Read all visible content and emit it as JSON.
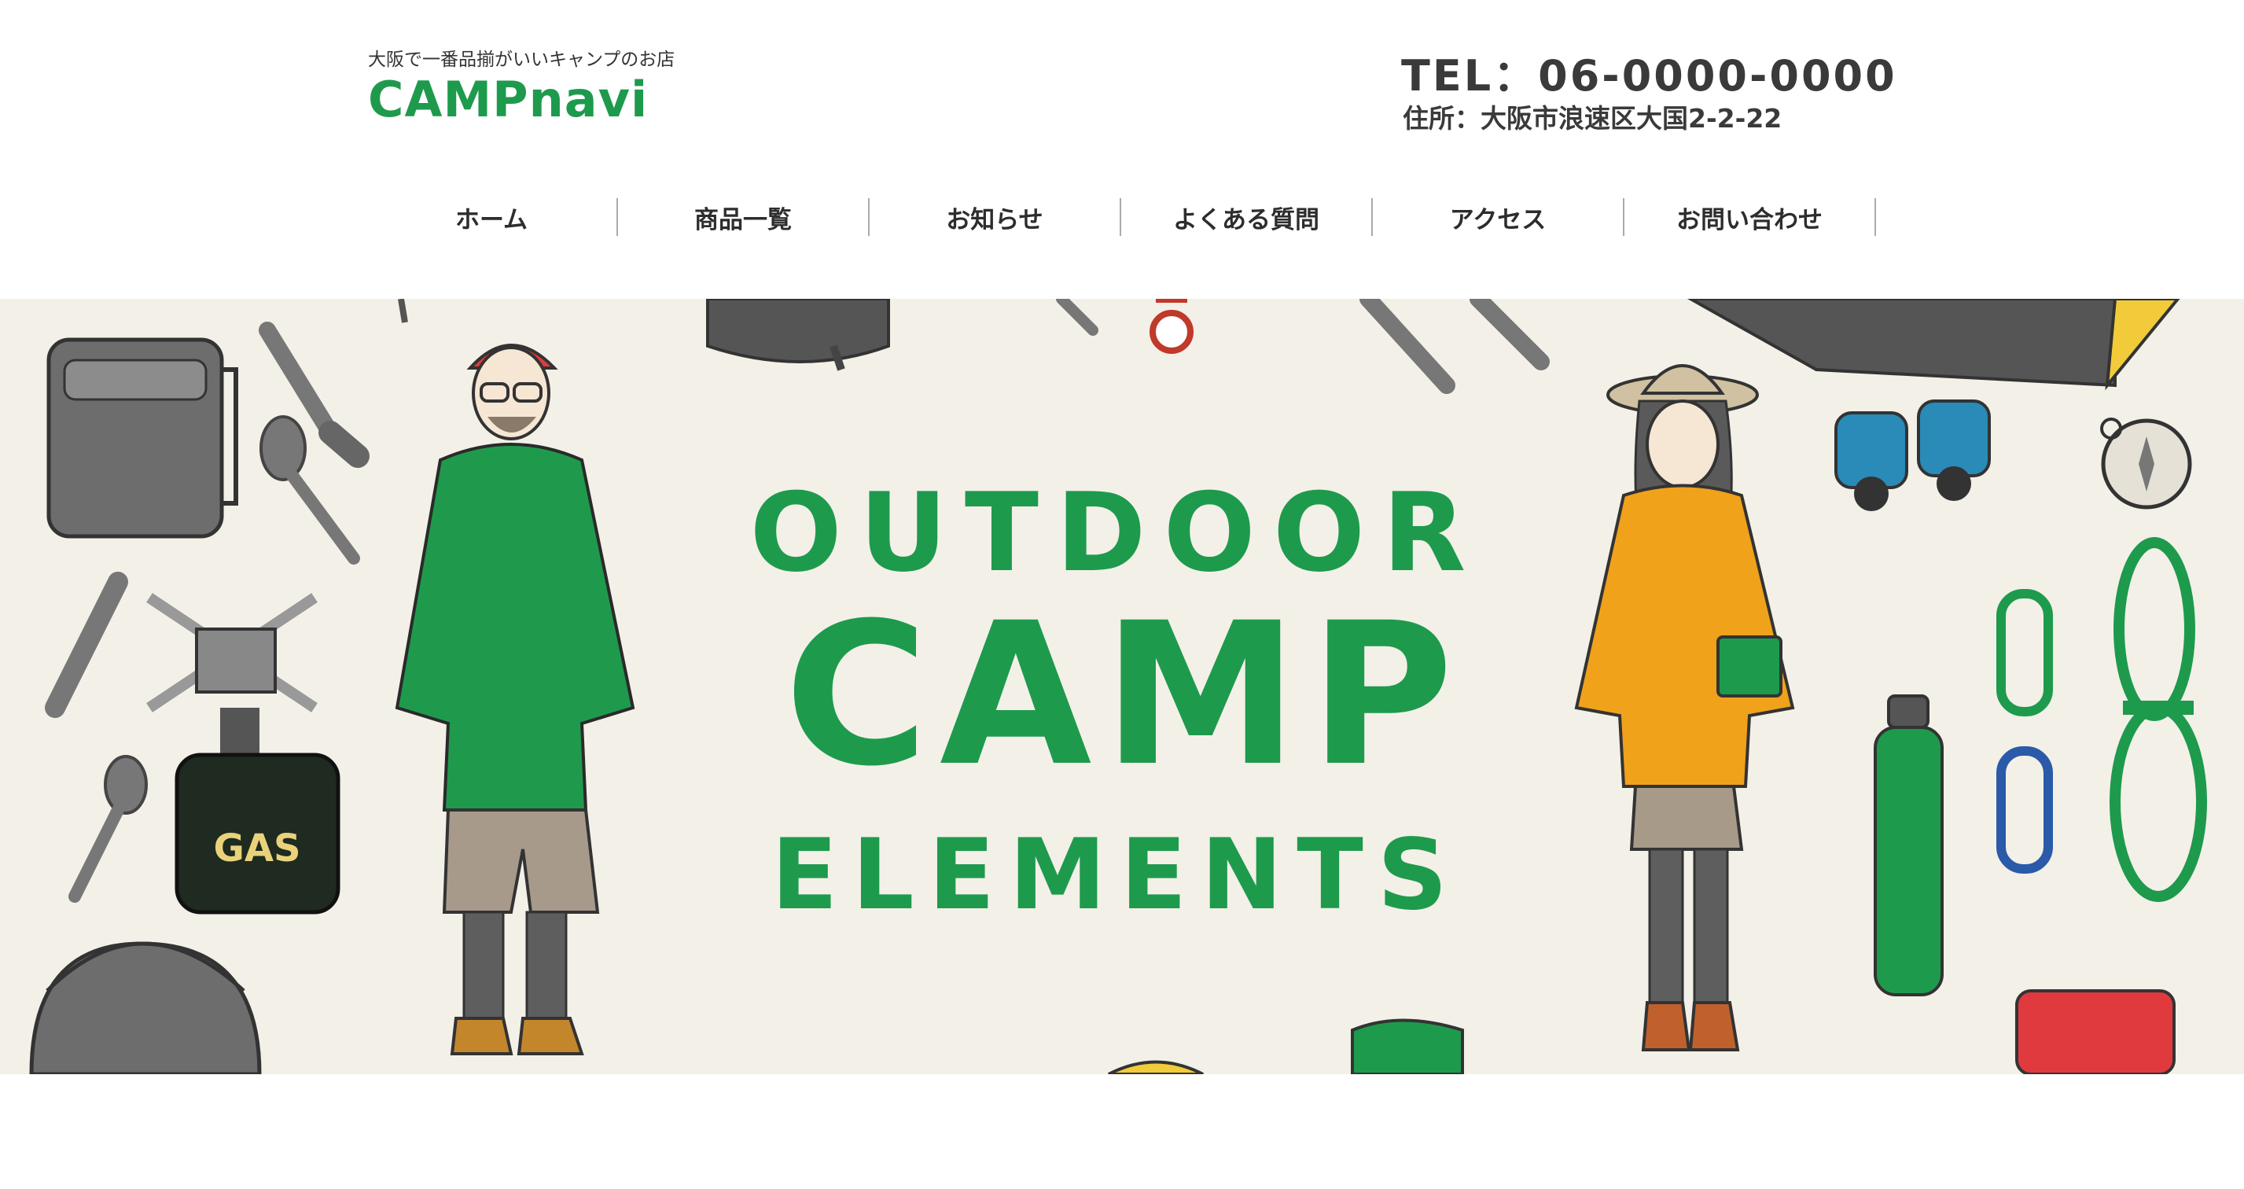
{
  "header": {
    "tagline": "大阪で一番品揃がいいキャンプのお店",
    "logo": "CAMPnavi",
    "tel": "TEL：06-0000-0000",
    "address": "住所：大阪市浪速区大国2-2-22"
  },
  "nav": [
    {
      "label": "ホーム"
    },
    {
      "label": "商品一覧"
    },
    {
      "label": "お知らせ"
    },
    {
      "label": "よくある質問"
    },
    {
      "label": "アクセス"
    },
    {
      "label": "お問い合わせ"
    }
  ],
  "hero": {
    "line1": "OUTDOOR",
    "line2": "CAMP",
    "line3": "ELEMENTS",
    "gas_label": "GAS",
    "colors": {
      "background": "#f3f0e8",
      "green": "#1e9a4d",
      "orange": "#f0a21b",
      "red": "#e03a3e",
      "blue": "#2a8ab8"
    }
  }
}
